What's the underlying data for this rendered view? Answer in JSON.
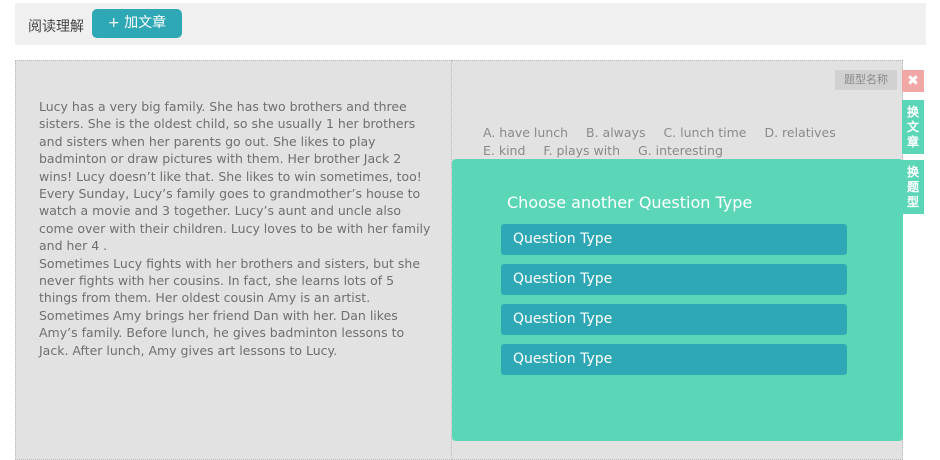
{
  "header": {
    "title": "阅读理解",
    "add_article_label": "+ 加文章"
  },
  "passage": {
    "paragraphs": [
      "Lucy has a very big family. She has two brothers and three sisters. She is the oldest child, so she usually   1   her brothers and sisters when her parents go out. She likes to play badminton or draw pictures with them. Her brother Jack   2   wins! Lucy doesn’t like that. She likes to win sometimes, too!",
      "Every Sunday, Lucy’s family goes to grandmother’s house to watch a movie and   3   together. Lucy’s aunt and uncle also come over with their children. Lucy loves to be with her family and her   4  .",
      "Sometimes Lucy fights with her brothers and sisters, but she never fights with her cousins. In fact, she learns lots of   5   things from them. Her oldest cousin Amy is an artist. Sometimes Amy brings her friend Dan with her. Dan likes Amy’s family. Before lunch, he gives badminton lessons to Jack. After lunch, Amy gives art lessons to Lucy."
    ]
  },
  "question": {
    "type_label": "题型名称",
    "options": [
      "A. have lunch",
      "B. always",
      "C. lunch time",
      "D. relatives",
      "E. kind",
      "F. plays with",
      "G. interesting"
    ]
  },
  "popup": {
    "title": "Choose another Question Type",
    "items": [
      "Question Type",
      "Question Type",
      "Question Type",
      "Question Type"
    ]
  },
  "sidebar": {
    "close_label": "✖",
    "change_article": "换文章",
    "change_question": "换题型"
  },
  "colors": {
    "accent": "#2fa8b5",
    "popup_bg": "#5bd6b7",
    "close_bg": "#f2a7a7"
  }
}
